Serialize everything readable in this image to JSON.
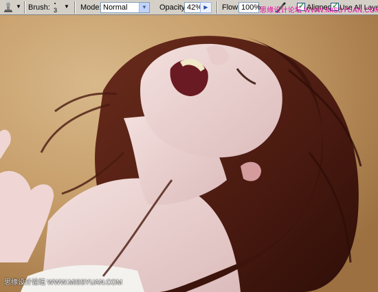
{
  "options_bar": {
    "tool_preset_icon": "clone-stamp-icon",
    "brush_label": "Brush:",
    "brush_size": "3",
    "mode_label": "Mode:",
    "mode_value": "Normal",
    "opacity_label": "Opacity:",
    "opacity_value": "42%",
    "flow_label": "Flow:",
    "flow_value": "100%",
    "airbrush_icon": "airbrush-icon",
    "aligned_label": "Aligned",
    "aligned_checked": true,
    "use_all_layers_label": "Use All Layers",
    "use_all_layers_checked": true
  },
  "watermark": {
    "top": "思缘设计论坛 WWW.MISSYUAN.COM",
    "bottom": "思缘设计论坛 WWW.MISSYUAN.COM"
  },
  "colors": {
    "toolbar_bg": "#d4d0c8",
    "backdrop": "#c8a070",
    "hair": "#4a1c12",
    "skin": "#ecd4d2",
    "watermark_top": "#e60099"
  }
}
